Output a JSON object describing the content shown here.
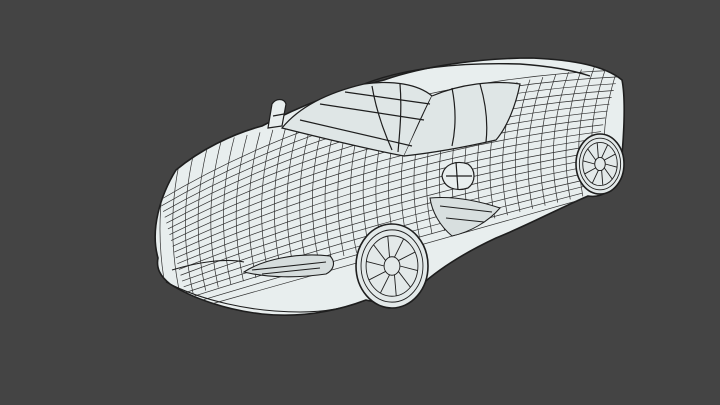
{
  "viewport": {
    "background": "#444444",
    "model_fill": "#e8eeee",
    "wire_color": "#2a2a2a",
    "subject": "sports-car-wireframe"
  }
}
